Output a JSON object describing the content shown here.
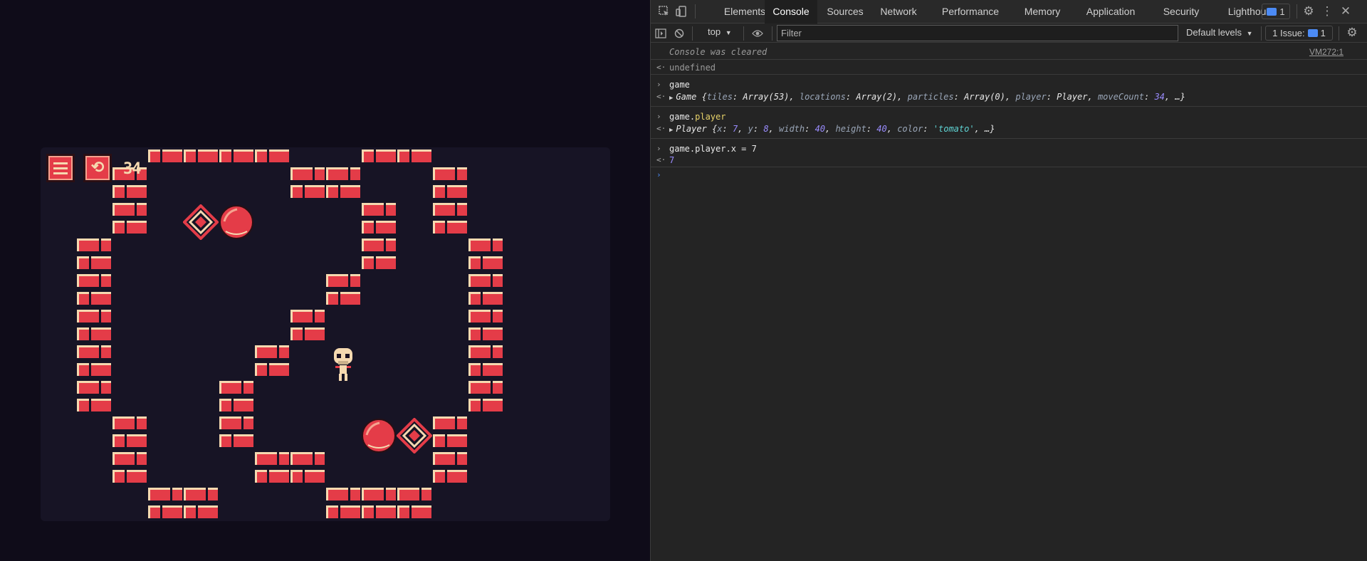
{
  "game": {
    "hud": {
      "menu_icon": "hamburger-icon",
      "undo_icon": "undo-icon",
      "move_count": "34"
    },
    "colors": {
      "brick": "#e43c48",
      "mortar": "#f5d9b0",
      "background": "#171425"
    }
  },
  "devtools": {
    "tabs": [
      {
        "label": "Elements"
      },
      {
        "label": "Console"
      },
      {
        "label": "Sources"
      },
      {
        "label": "Network"
      },
      {
        "label": "Performance"
      },
      {
        "label": "Memory"
      },
      {
        "label": "Application"
      },
      {
        "label": "Security"
      },
      {
        "label": "Lighthouse"
      }
    ],
    "message_badge_count": "1",
    "toolbar": {
      "context": "top",
      "filter_placeholder": "Filter",
      "levels": "Default levels",
      "issues_label": "1 Issue:",
      "issues_count": "1"
    },
    "console": {
      "cleared": "Console was cleared",
      "cleared_source": "VM272:1",
      "undefined": "undefined",
      "cmd1": "game",
      "res1_class": "Game",
      "res1_body": [
        {
          "k": "tiles",
          "v": "Array(53)",
          "t": "obj"
        },
        {
          "k": "locations",
          "v": "Array(2)",
          "t": "obj"
        },
        {
          "k": "particles",
          "v": "Array(0)",
          "t": "obj"
        },
        {
          "k": "player",
          "v": "Player",
          "t": "obj"
        },
        {
          "k": "moveCount",
          "v": "34",
          "t": "num"
        }
      ],
      "cmd2_obj": "game.",
      "cmd2_prop": "player",
      "res2_class": "Player",
      "res2_body": [
        {
          "k": "x",
          "v": "7",
          "t": "num"
        },
        {
          "k": "y",
          "v": "8",
          "t": "num"
        },
        {
          "k": "width",
          "v": "40",
          "t": "num"
        },
        {
          "k": "height",
          "v": "40",
          "t": "num"
        },
        {
          "k": "color",
          "v": "'tomato'",
          "t": "str"
        }
      ],
      "cmd3": "game.player.x = 7",
      "res3": "7"
    }
  }
}
